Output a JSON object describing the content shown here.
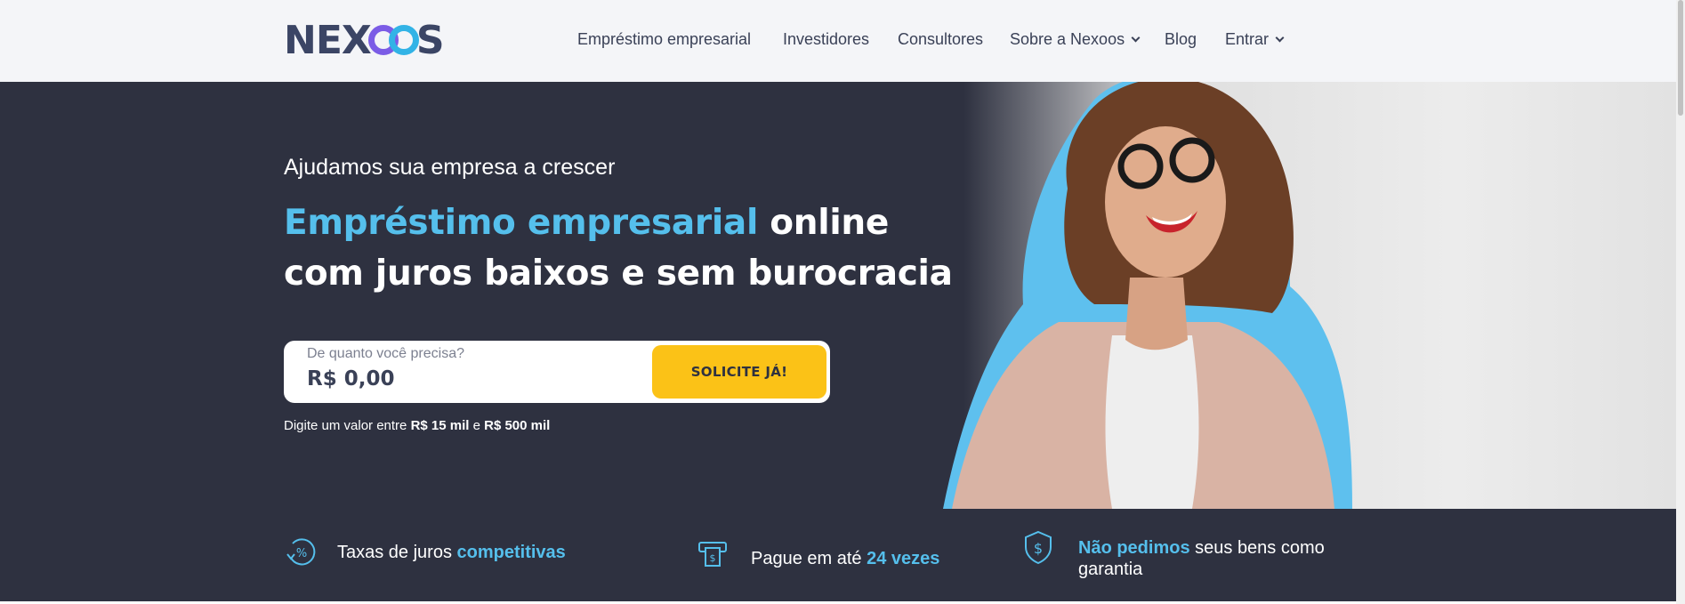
{
  "header": {
    "logo": {
      "prefix": "NEX",
      "suffix": "S"
    },
    "nav": [
      {
        "label": "Empréstimo empresarial",
        "dropdown": false
      },
      {
        "label": "Investidores",
        "dropdown": false
      },
      {
        "label": "Consultores",
        "dropdown": false
      },
      {
        "label": "Sobre a Nexoos",
        "dropdown": true
      },
      {
        "label": "Blog",
        "dropdown": false
      },
      {
        "label": "Entrar",
        "dropdown": true
      }
    ]
  },
  "hero": {
    "subtitle": "Ajudamos sua empresa a crescer",
    "headline_accent": "Empréstimo empresarial",
    "headline_rest_1": " online",
    "headline_rest_2": "com juros baixos e sem burocracia",
    "amount": {
      "label": "De quanto você precisa?",
      "value": "R$ 0,00"
    },
    "cta_label": "SOLICITE JÁ!",
    "hint": {
      "prefix": "Digite um valor entre ",
      "min": "R$ 15 mil",
      "middle": " e ",
      "max": "R$ 500 mil"
    }
  },
  "benefits": [
    {
      "icon": "percent-cycle-icon",
      "text": "Taxas de juros ",
      "accent": "competitivas",
      "accent_first": false
    },
    {
      "icon": "bill-icon",
      "text": "Pague em até ",
      "accent": "24 vezes",
      "accent_first": false
    },
    {
      "icon": "shield-dollar-icon",
      "text": " seus bens como garantia",
      "accent": "Não pedimos",
      "accent_first": true
    }
  ],
  "colors": {
    "dark_bg": "#2e3140",
    "accent_blue": "#55bfec",
    "cta_yellow": "#fbc217",
    "header_bg": "#f4f5f8"
  }
}
